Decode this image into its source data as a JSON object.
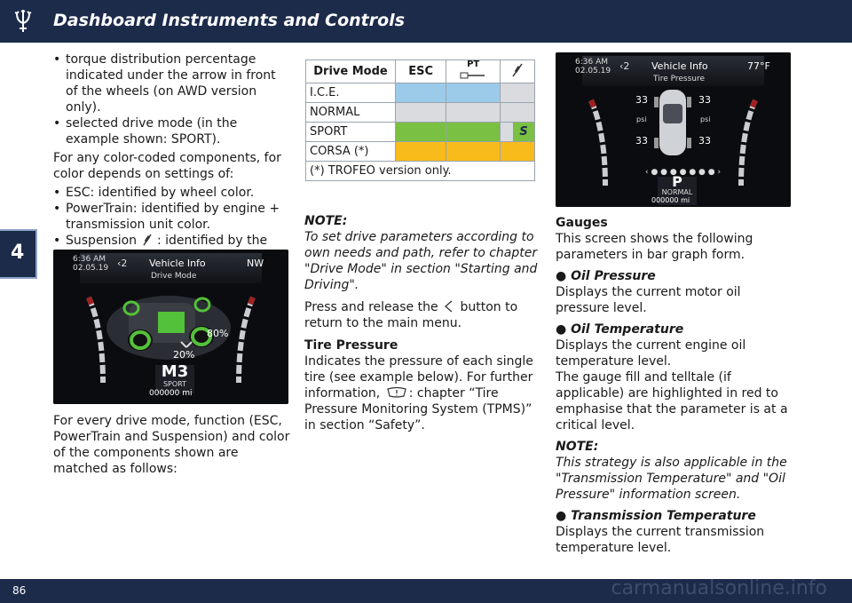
{
  "header": {
    "title": "Dashboard Instruments and Controls"
  },
  "chapter_tab": "4",
  "footer": {
    "page_number": "86",
    "watermark": "carmanualsonline.info"
  },
  "col1": {
    "bullets1": [
      "torque distribution percentage indicated under the arrow in front of the wheels (on AWD version only).",
      "selected drive mode (in the example shown: SPORT)."
    ],
    "para1": "For any color-coded components, for color depends on settings of:",
    "bullet_esc": "ESC: identified by wheel color.",
    "bullet_pt": "PowerTrain: identified by engine + transmission unit color.",
    "bullet_susp_a": "Suspension",
    "bullet_susp_b": ": identified by the color of the four shock absorbers.",
    "para2": "For every drive mode, function (ESC, PowerTrain and Suspension) and color of the components shown are matched as follows:"
  },
  "screen1": {
    "time": "6:36 AM",
    "date": "02.05.19",
    "page_indicator": "2",
    "title": "Vehicle Info",
    "subtitle": "Drive Mode",
    "compass": "NW",
    "pct_rear": "80%",
    "pct_front": "20%",
    "gear": "M3",
    "mode": "SPORT",
    "odometer": "000000",
    "odometer_unit": "mi"
  },
  "table": {
    "header": {
      "mode": "Drive Mode",
      "esc": "ESC",
      "pt": "PT"
    },
    "rows": [
      "I.C.E.",
      "NORMAL",
      "SPORT",
      "CORSA (*)"
    ],
    "footnote": "(*) TROFEO version only.",
    "sport_badge": "S"
  },
  "col2": {
    "note_title": "NOTE:",
    "note_text": "To set drive parameters according to own needs and path, refer to chapter \"Drive Mode\" in section \"Starting and Driving\".",
    "press_a": "Press and release the",
    "press_b": "button to return to the main menu.",
    "tire_title": "Tire Pressure",
    "tire_text_a": "Indicates the pressure of each single tire (see example below). For further information,",
    "tire_text_b": ": chapter “Tire Pressure Monitoring System (TPMS)” in section “Safety”."
  },
  "screen2": {
    "time": "6:36 AM",
    "date": "02.05.19",
    "page_indicator": "2",
    "title": "Vehicle Info",
    "subtitle": "Tire Pressure",
    "temp": "77°F",
    "fl": "33",
    "fr": "33",
    "rl": "33",
    "rr": "33",
    "unit_left": "psi",
    "unit_right": "psi",
    "gear": "P",
    "mode": "NORMAL",
    "odometer": "000000",
    "odometer_unit": "mi"
  },
  "col3": {
    "gauges_title": "Gauges",
    "gauges_text": "This screen shows the following parameters in bar graph form.",
    "oil_p_title": "Oil Pressure",
    "oil_p_text": "Displays the current motor oil pressure level.",
    "oil_t_title": "Oil Temperature",
    "oil_t_text": "Displays the current engine oil temperature level.",
    "gauge_fill_text": "The gauge fill and telltale (if applicable) are highlighted in red to emphasise that the parameter is at a critical level.",
    "note_title": "NOTE:",
    "note_text": "This strategy is also applicable in the \"Transmission Temperature\" and \"Oil Pressure\" information screen.",
    "trans_title": "Transmission Temperature",
    "trans_text": "Displays the current transmission temperature level."
  }
}
